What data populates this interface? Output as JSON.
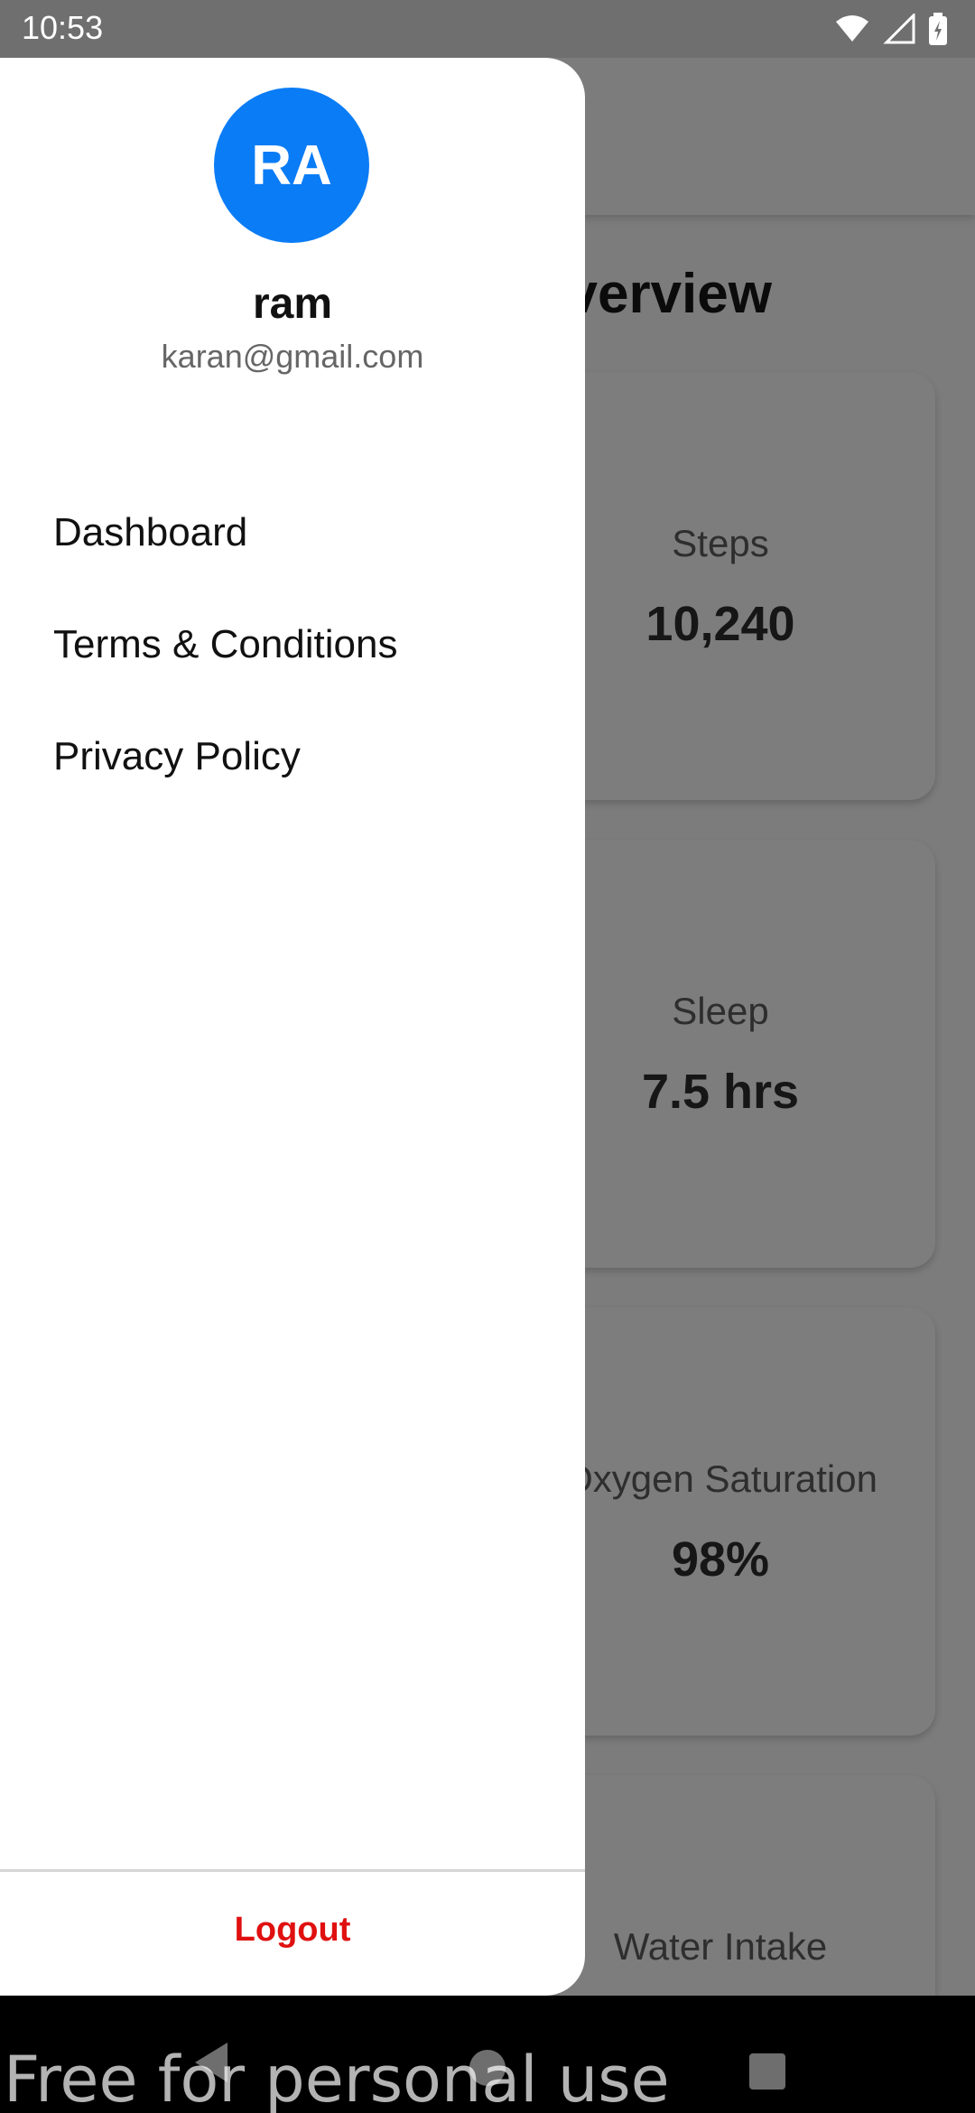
{
  "status_bar": {
    "time": "10:53"
  },
  "background": {
    "title": "Overview",
    "title_visible": "verview",
    "metrics": [
      {
        "label": "Steps",
        "value": "10,240"
      },
      {
        "label": "Sleep",
        "value": "7.5 hrs"
      },
      {
        "label": "Oxygen Saturation",
        "label_visible": "xygen Saturation",
        "value": "98%"
      },
      {
        "label": "Water Intake",
        "value": ""
      }
    ]
  },
  "drawer": {
    "avatar_initials": "RA",
    "name": "ram",
    "email": "karan@gmail.com",
    "menu": [
      "Dashboard",
      "Terms & Conditions",
      "Privacy Policy"
    ],
    "logout_label": "Logout"
  },
  "watermark": "Free for personal use",
  "colors": {
    "accent": "#0a7cf5",
    "logout": "#e01010",
    "scrim": "#7c7c7c"
  }
}
